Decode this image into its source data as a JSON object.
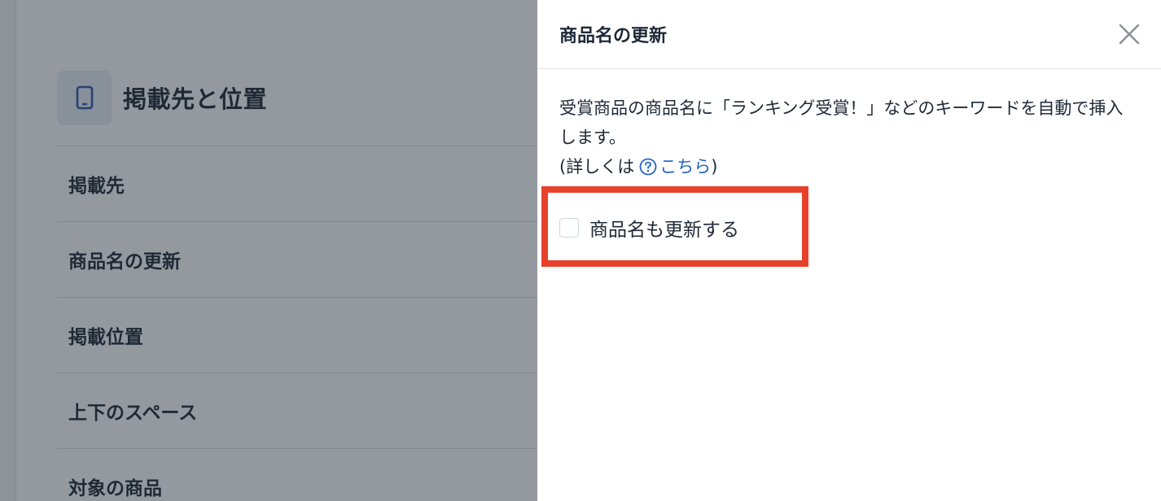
{
  "background": {
    "section_title": "掲載先と位置",
    "section_icon": "smartphone-icon",
    "rows": [
      {
        "label": "掲載先"
      },
      {
        "label": "商品名の更新"
      },
      {
        "label": "掲載位置"
      },
      {
        "label": "上下のスペース"
      },
      {
        "label": "対象の商品"
      }
    ]
  },
  "drawer": {
    "title": "商品名の更新",
    "close_icon": "close-icon",
    "description": "受賞商品の商品名に「ランキング受賞！」などのキーワードを自動で挿入します。",
    "detail_prefix": "(詳しくは",
    "help_link_label": "こちら",
    "detail_suffix": ")",
    "help_icon": "question-circle-icon",
    "checkbox_label": "商品名も更新する",
    "checkbox_checked": false
  },
  "colors": {
    "highlight": "#e8412b",
    "link": "#2563c7",
    "overlay": "rgba(31,41,55,0.48)"
  }
}
